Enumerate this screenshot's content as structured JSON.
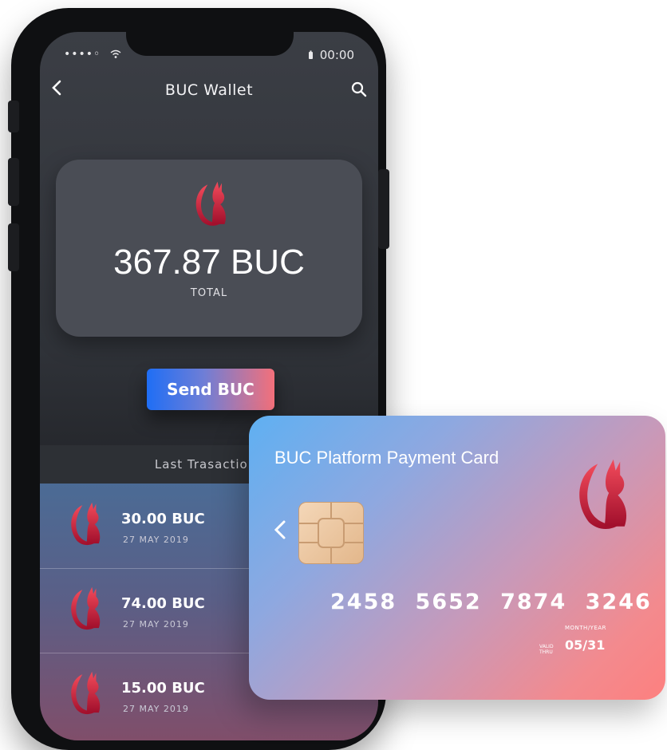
{
  "status": {
    "signal": "••••◦",
    "time": "00:00"
  },
  "nav": {
    "title": "BUC Wallet"
  },
  "balance": {
    "amount": "367.87 BUC",
    "label": "TOTAL"
  },
  "send_button": "Send BUC",
  "transactions": {
    "header": "Last Trasactions",
    "items": [
      {
        "amount": "30.00 BUC",
        "date": "27 MAY 2019"
      },
      {
        "amount": "74.00 BUC",
        "date": "27 MAY 2019"
      },
      {
        "amount": "15.00 BUC",
        "date": "27 MAY 2019"
      }
    ]
  },
  "card": {
    "title": "BUC Platform Payment Card",
    "number": "2458 5652 7874 3246",
    "expiry_label": "MONTH/YEAR",
    "valid_thru": "VALID THRU",
    "expiry": "05/31"
  },
  "icons": {
    "back": "chevron-left-icon",
    "search": "search-icon",
    "logo": "cat-logo-icon",
    "chip": "sim-chip-icon"
  },
  "colors": {
    "button_gradient_start": "#1f6ef5",
    "button_gradient_end": "#f3707a",
    "card_gradient_start": "#5fb0f2",
    "card_gradient_end": "#fd807f",
    "logo_red": "#d3173d"
  }
}
